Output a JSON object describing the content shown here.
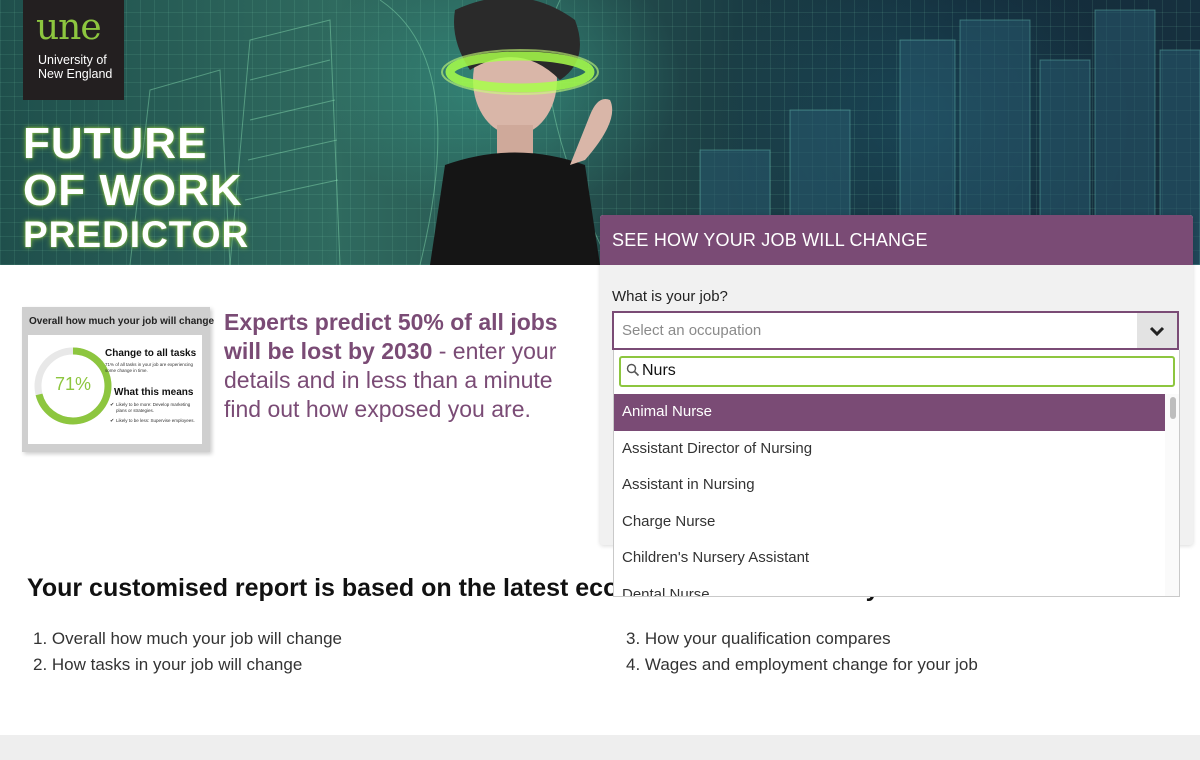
{
  "brand": {
    "logo_text": "une",
    "logo_subtext": "University of New England",
    "accent_green": "#8dc63f",
    "accent_purple": "#7a4b75"
  },
  "hero": {
    "title_line1": "FUTURE",
    "title_line2": "OF WORK",
    "title_line3": "PREDICTOR"
  },
  "panel": {
    "heading": "SEE HOW YOUR JOB WILL CHANGE",
    "job_label": "What is your job?",
    "select_placeholder": "Select an occupation",
    "search_value": "Nurs",
    "options": [
      "Animal Nurse",
      "Assistant Director of Nursing",
      "Assistant in Nursing",
      "Charge Nurse",
      "Children's Nursery Assistant",
      "Dental Nurse"
    ],
    "selected_index": 0
  },
  "preview": {
    "title": "Overall how much your job will change",
    "percent": "71%",
    "percent_value": 0.71,
    "change_heading": "Change to all tasks",
    "change_text": "71% of all tasks in your job are experiencing some change in time.",
    "means_heading": "What this means",
    "bullet_more": "Likely to be more: Develop marketing plans or strategies.",
    "bullet_less": "Likely to be less: Supervise employees."
  },
  "intro": {
    "highlight": "Experts predict 50% of all jobs will be lost by 2030",
    "rest": " - enter your details and in less than a minute find out how exposed you are."
  },
  "report": {
    "heading": "Your customised report is based on the latest economic data and tells you:",
    "items_left": [
      "1. Overall how much your job will change",
      "2. How tasks in your job will change"
    ],
    "items_right": [
      "3. How your qualification compares",
      "4. Wages and employment change for your job"
    ]
  },
  "icons": {
    "search": "search-icon",
    "dropdown": "chevron-down-icon"
  }
}
